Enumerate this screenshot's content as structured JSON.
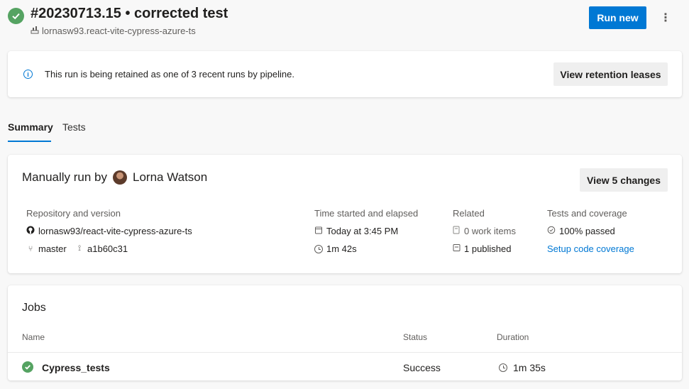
{
  "header": {
    "title": "#20230713.15 • corrected test",
    "repo": "lornasw93.react-vite-cypress-azure-ts",
    "run_new_label": "Run new",
    "more_label": "⋮"
  },
  "retention": {
    "message": "This run is being retained as one of 3 recent runs by pipeline.",
    "button_label": "View retention leases"
  },
  "tabs": [
    {
      "label": "Summary",
      "selected": true
    },
    {
      "label": "Tests",
      "selected": false
    }
  ],
  "summary": {
    "run_by_prefix": "Manually run by",
    "run_by_user": "Lorna Watson",
    "view_changes_label": "View 5 changes",
    "repository": {
      "heading": "Repository and version",
      "repo": "lornasw93/react-vite-cypress-azure-ts",
      "branch": "master",
      "commit": "a1b60c31"
    },
    "time": {
      "heading": "Time started and elapsed",
      "started": "Today at 3:45 PM",
      "elapsed": "1m 42s"
    },
    "related": {
      "heading": "Related",
      "work_items": "0 work items",
      "published": "1 published"
    },
    "tests": {
      "heading": "Tests and coverage",
      "passed": "100% passed",
      "coverage_link": "Setup code coverage"
    }
  },
  "jobs": {
    "title": "Jobs",
    "columns": [
      "Name",
      "Status",
      "Duration"
    ],
    "rows": [
      {
        "name": "Cypress_tests",
        "status": "Success",
        "duration": "1m 35s"
      }
    ]
  },
  "colors": {
    "accent": "#0078d4",
    "success": "#55a362"
  }
}
